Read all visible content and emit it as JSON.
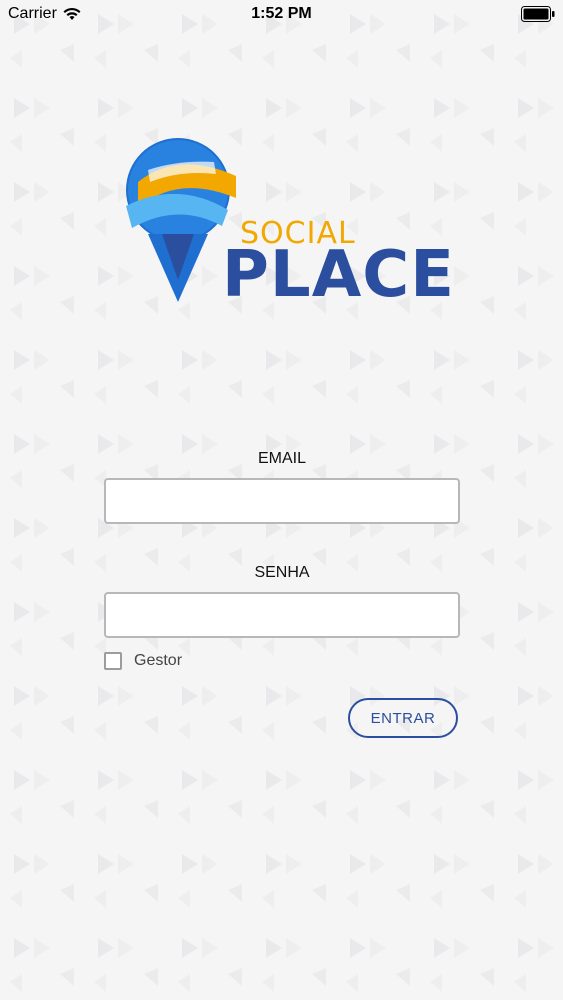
{
  "status_bar": {
    "carrier": "Carrier",
    "time": "1:52 PM",
    "wifi_icon": "wifi-icon",
    "battery_icon": "battery-icon"
  },
  "logo": {
    "word_top": "SOCIAL",
    "word_bottom": "PLACE",
    "colors": {
      "orange": "#f2a800",
      "blue": "#2b4f9e",
      "globe": "#1e6fd0"
    }
  },
  "form": {
    "email_label": "EMAIL",
    "email_value": "",
    "password_label": "SENHA",
    "password_value": "",
    "gestor_checkbox_label": "Gestor",
    "gestor_checked": false,
    "submit_label": "ENTRAR"
  }
}
